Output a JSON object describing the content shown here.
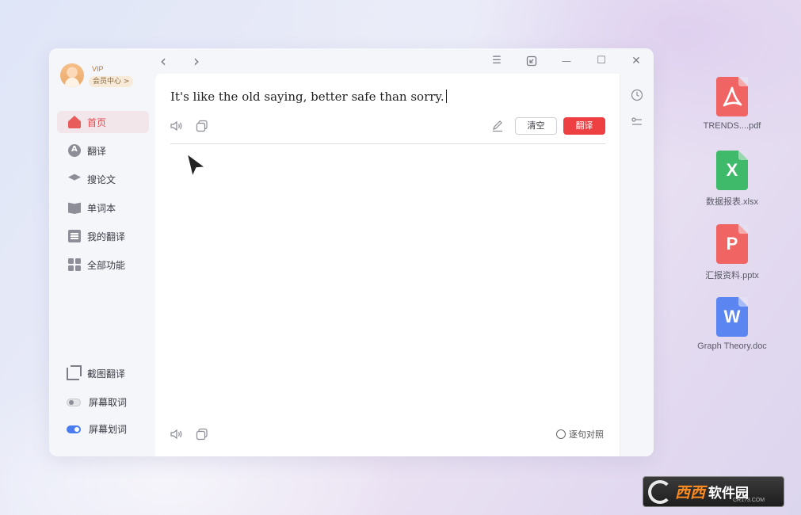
{
  "user": {
    "badge": "VIP",
    "member_center": "会员中心 >"
  },
  "sidebar": {
    "items": [
      {
        "label": "首页",
        "icon": "home-icon",
        "active": true
      },
      {
        "label": "翻译",
        "icon": "translate-icon"
      },
      {
        "label": "搜论文",
        "icon": "paper-search-icon"
      },
      {
        "label": "单词本",
        "icon": "wordbook-icon"
      },
      {
        "label": "我的翻译",
        "icon": "my-translation-icon"
      },
      {
        "label": "全部功能",
        "icon": "all-functions-icon"
      }
    ],
    "bottom": [
      {
        "label": "截图翻译",
        "icon": "crop-icon"
      },
      {
        "label": "屏幕取词",
        "icon": "toggle-off",
        "enabled": false
      },
      {
        "label": "屏幕划词",
        "icon": "toggle-on",
        "enabled": true
      }
    ]
  },
  "toolbar": {
    "back": "‹",
    "forward": "›",
    "menu": "☰",
    "minimize": "—",
    "maximize": "☐",
    "close": "✕"
  },
  "editor": {
    "source_text": "It's like the old saying, better safe than sorry.",
    "clear_label": "清空",
    "translate_label": "翻译",
    "sentence_compare_label": "逐句对照"
  },
  "desktop": {
    "files": [
      {
        "name": "TRENDS....pdf",
        "type": "pdf",
        "color": "#f06464",
        "glyph": "pdf-icon"
      },
      {
        "name": "数据报表.xlsx",
        "type": "xlsx",
        "color": "#3fba6a",
        "glyph": "X"
      },
      {
        "name": "汇报资料.pptx",
        "type": "pptx",
        "color": "#f06464",
        "glyph": "P"
      },
      {
        "name": "Graph Theory.doc",
        "type": "doc",
        "color": "#5b86f2",
        "glyph": "W"
      }
    ]
  },
  "watermark": {
    "brand": "西西",
    "text": "软件园",
    "sub": "CR173.COM"
  },
  "colors": {
    "accent": "#ee3f42",
    "toggle_on": "#4a7cf0",
    "active_bg": "#f2e6ea"
  }
}
